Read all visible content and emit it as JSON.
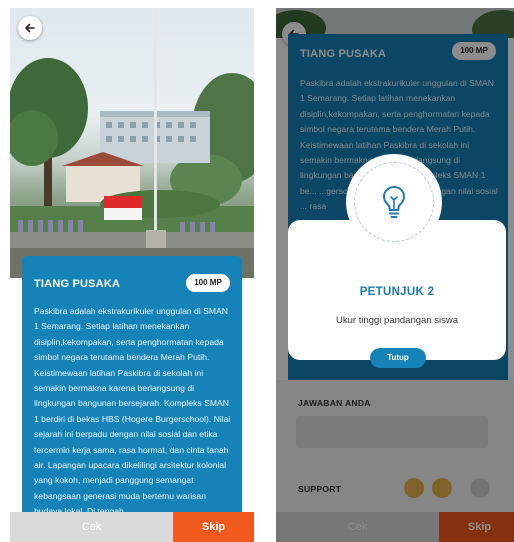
{
  "left_screen": {
    "card": {
      "title": "TIANG PUSAKA",
      "badge": "100 MP",
      "body": "Paskibra adalah ekstrakurikuler unggulan di SMAN 1 Semarang. Setiap latihan menekankan disiplin,kekompakan, serta penghormatan kepada simbol negara terutama bendera Merah Putih. Keistimewaan latihan Paskibra di sekolah ini semakin bermakna karena berlangsung di lingkungan bangunan bersejarah. Kompleks SMAN 1 berdiri di bekas HBS (Hogere Burgerschool). Nilai sejarah ini berpadu dengan nilai sosial dan etika tercermin kerja sama, rasa hormat, dan cinta tanah air. Lapangan upacara dikelilingi arsitektur kolonial yang kokoh, menjadi panggung semangat kebangsaan generasi muda bertemu warisan budaya lokal. Di tengah"
    },
    "buttons": {
      "check": "Cek",
      "skip": "Skip"
    },
    "back_icon": "arrow-left-icon"
  },
  "right_screen": {
    "card": {
      "title": "TIANG PUSAKA",
      "badge": "100 MP",
      "body": "Paskibra adalah ekstrakurikuler unggulan di SMAN 1 Semarang. Setiap latihan menekankan disiplin,kekompakan, serta penghormatan kepada simbol negara terutama bendera Merah Putih. Keistimewaan latihan Paskibra di sekolah ini semakin bermakna karena berlangsung di lingkungan ban... bersejarah. Kompleks SMAN 1 be... ...gerschool). Burgersch... ...dengan nilai sosial ... rasa"
    },
    "answer_section": {
      "label": "JAWABAN ANDA"
    },
    "support_section": {
      "label": "SUPPORT"
    },
    "modal": {
      "icon": "lightbulb-icon",
      "title": "PETUNJUK 2",
      "text": "Ukur tinggi pandangan siswa",
      "close_label": "Tutup"
    },
    "buttons": {
      "check": "Cek",
      "skip": "Skip"
    },
    "back_icon": "arrow-left-icon"
  },
  "colors": {
    "card_blue": "#1582b8",
    "skip_orange": "#f25a1d",
    "check_gray": "#d9d9d9",
    "support_gold": "#e5b34c"
  }
}
